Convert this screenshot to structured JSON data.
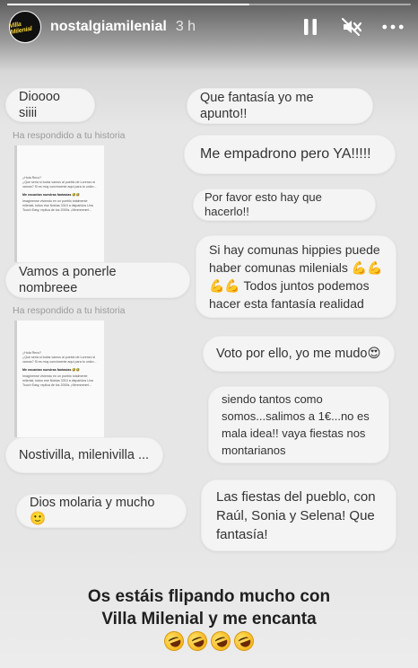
{
  "header": {
    "username": "nostalgiamilenial",
    "time": "3 h",
    "avatar_text": "Villa Milenial",
    "icons": [
      "pause-icon",
      "mute-icon",
      "more-icon"
    ]
  },
  "progress": {
    "fraction": 0.6
  },
  "left_messages": [
    {
      "text": "Dioooo siiii"
    },
    {
      "text": "Vamos a ponerle nombreee"
    },
    {
      "text": "Nostivilla, milenivilla ..."
    },
    {
      "text": "Dios molaria y mucho 🙂"
    }
  ],
  "reply_labels": [
    "Ha respondido a tu historia",
    "Ha respondido a tu historia"
  ],
  "story_thumb": {
    "line1": "¿Hola Reco?",
    "line2": "¿Que sería si todos vamos al pueblo de Lorenzo si vamos? Si es muy convincente aquí para tu unión...",
    "bold": "Me encantan nuestras fantasias 🤣🤣",
    "line3": "Imagínense viviendo en un pueblo totalmente milenial, todos ese Nokias 3310 a disparidos Una Touch Easy, replica de los 2000s. ¡Mmmmmm!..."
  },
  "right_messages": [
    {
      "text": "Que fantasía yo me apunto!!"
    },
    {
      "text": "Me empadrono pero YA!!!!!"
    },
    {
      "text": "Por favor esto hay que hacerlo!!"
    },
    {
      "text": "Si hay comunas hippies puede haber comunas milenials 💪💪 💪💪 Todos juntos podemos hacer esta fantasía realidad"
    },
    {
      "text": "Voto por ello, yo me mudo😍"
    },
    {
      "text": "siendo tantos como somos...salimos a 1€...no es mala idea!! vaya fiestas nos montarianos"
    },
    {
      "text": "Las fiestas del pueblo, con Raúl, Sonia y Selena! Que fantasía!"
    }
  ],
  "caption": {
    "line1": "Os estáis flipando mucho con",
    "line2": "Villa Milenial y me encanta",
    "emojis": [
      "🤣",
      "🤣",
      "🤣",
      "🤣"
    ]
  },
  "colors": {
    "bubble": "#f4f4f4",
    "text": "#333333",
    "label": "#9a9a9a",
    "avatar_accent": "#f3d23a"
  }
}
